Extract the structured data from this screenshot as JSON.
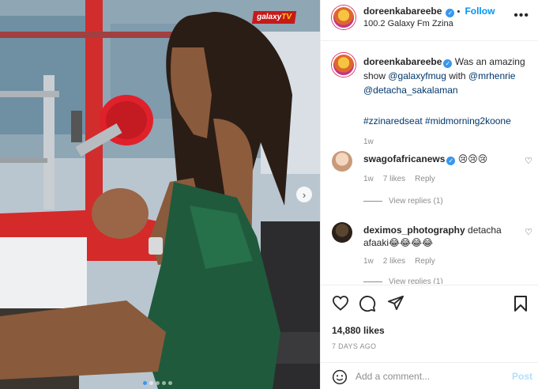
{
  "header": {
    "username": "doreenkabareebe",
    "verified_icon": "verified-badge-icon",
    "separator": "•",
    "follow_label": "Follow",
    "location": "100.2 Galaxy Fm Zzina",
    "more_icon": "more-options-icon"
  },
  "media": {
    "overlay_logo_text_1": "galaxy",
    "overlay_logo_text_2": "TV",
    "carousel_dots": 5,
    "active_dot": 0,
    "next_icon": "chevron-right-icon"
  },
  "caption": {
    "username": "doreenkabareebe",
    "text_before": " Was an amazing show ",
    "mention1": "@galaxyfmug",
    "text_mid": " with ",
    "mention2": "@mrhenrie",
    "mention3": "@detacha_sakalaman",
    "hashtags": "#zzinaredseat #midmorning2koone",
    "time": "1w"
  },
  "comments": [
    {
      "username": "swagofafricanews",
      "verified": true,
      "text": "😢😢😢",
      "time": "1w",
      "likes": "7 likes",
      "reply_label": "Reply",
      "view_replies": "View replies (1)"
    },
    {
      "username": "deximos_photography",
      "verified": false,
      "text": "detacha afaaki😂😂😂😂",
      "time": "1w",
      "likes": "2 likes",
      "reply_label": "Reply",
      "view_replies": "View replies (1)"
    }
  ],
  "actions": {
    "like_icon": "heart-icon",
    "comment_icon": "comment-icon",
    "share_icon": "share-icon",
    "save_icon": "bookmark-icon",
    "likes_count": "14,880 likes",
    "date": "7 DAYS AGO"
  },
  "add_comment": {
    "emoji_icon": "smiley-icon",
    "placeholder": "Add a comment...",
    "post_label": "Post"
  },
  "colors": {
    "link_blue": "#0095f6",
    "mention_dark_blue": "#00376b",
    "muted_gray": "#8e8e8e",
    "post_disabled": "#b2dffc",
    "mic_red": "#e0202a",
    "dress_green": "#1f5a3c"
  }
}
